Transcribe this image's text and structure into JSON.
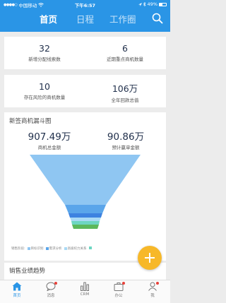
{
  "status_bar": {
    "carrier": "中国移动",
    "signal": "●●●●○",
    "time": "下午6:57",
    "battery_pct": "49%"
  },
  "tabs": [
    {
      "label": "首页",
      "active": true
    },
    {
      "label": "日程",
      "active": false
    },
    {
      "label": "工作圈",
      "active": false
    }
  ],
  "stats_top": [
    {
      "value": "32",
      "label": "新增分配线索数"
    },
    {
      "value": "6",
      "label": "近期重点商机数量"
    }
  ],
  "stats_mid": [
    {
      "value": "10",
      "label": "存在风险的商机数量"
    },
    {
      "value": "106万",
      "label": "全年回款总值"
    }
  ],
  "funnel": {
    "title": "新签商机漏斗图",
    "total_amount": "907.49万",
    "total_label": "商机总金额",
    "forecast_amount": "90.86万",
    "forecast_label": "预计赢单金额",
    "legend_prefix": "销售阶段:",
    "legend": [
      {
        "label": "目标识别",
        "color": "#8fc6f2"
      },
      {
        "label": "需求分析",
        "color": "#5aa5ea"
      },
      {
        "label": "高级权力关系",
        "color": "#a9d9f5"
      },
      {
        "label": "",
        "color": "#6dd6c2"
      }
    ],
    "stage_colors": [
      "#8fc6f2",
      "#5aa5ea",
      "#3d82e0",
      "#a9d9f5",
      "#6dd6c2",
      "#5cb85c"
    ]
  },
  "sales_title": "销售业绩趋势",
  "bottom_nav": [
    {
      "label": "首页",
      "icon": "home-icon",
      "active": true
    },
    {
      "label": "消息",
      "icon": "chat-icon",
      "active": false
    },
    {
      "label": "CRM",
      "icon": "crm-chart-icon",
      "active": false
    },
    {
      "label": "办公",
      "icon": "briefcase-icon",
      "active": false
    },
    {
      "label": "我",
      "icon": "person-icon",
      "active": false
    }
  ]
}
